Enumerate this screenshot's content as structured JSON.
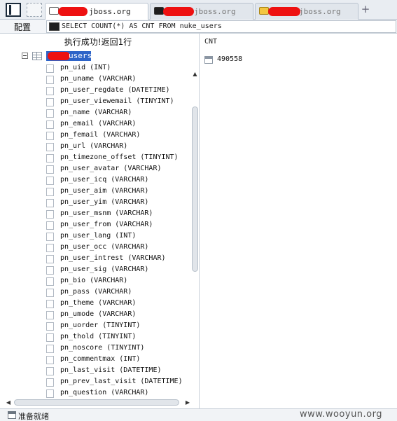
{
  "tabs": [
    {
      "label": "jboss.org",
      "icon": "document-icon",
      "active": true
    },
    {
      "label": "jboss.org",
      "icon": "terminal-icon",
      "active": false
    },
    {
      "label": "jboss.org",
      "icon": "database-icon",
      "active": false
    }
  ],
  "add_tab_label": "+",
  "sqlbar": {
    "config_label": "配置",
    "query": "SELECT COUNT(*) AS CNT FROM nuke_users"
  },
  "left": {
    "status_message": "执行成功!返回1行",
    "root_table": "users",
    "columns": [
      "pn_uid (INT)",
      "pn_uname (VARCHAR)",
      "pn_user_regdate (DATETIME)",
      "pn_user_viewemail (TINYINT)",
      "pn_name (VARCHAR)",
      "pn_email (VARCHAR)",
      "pn_femail (VARCHAR)",
      "pn_url (VARCHAR)",
      "pn_timezone_offset (TINYINT)",
      "pn_user_avatar (VARCHAR)",
      "pn_user_icq (VARCHAR)",
      "pn_user_aim (VARCHAR)",
      "pn_user_yim (VARCHAR)",
      "pn_user_msnm (VARCHAR)",
      "pn_user_from (VARCHAR)",
      "pn_user_lang (INT)",
      "pn_user_occ (VARCHAR)",
      "pn_user_intrest (VARCHAR)",
      "pn_user_sig (VARCHAR)",
      "pn_bio (VARCHAR)",
      "pn_pass (VARCHAR)",
      "pn_theme (VARCHAR)",
      "pn_umode (VARCHAR)",
      "pn_uorder (TINYINT)",
      "pn_thold (TINYINT)",
      "pn_noscore (TINYINT)",
      "pn_commentmax (INT)",
      "pn_last_visit (DATETIME)",
      "pn_prev_last_visit (DATETIME)",
      "pn_question (VARCHAR)"
    ]
  },
  "right": {
    "column_header": "CNT",
    "result_value": "490558"
  },
  "statusbar": {
    "text": "准备就绪",
    "watermark": "www.wooyun.org"
  },
  "colors": {
    "redaction": "#ee1111",
    "selection": "#2e64c8"
  }
}
